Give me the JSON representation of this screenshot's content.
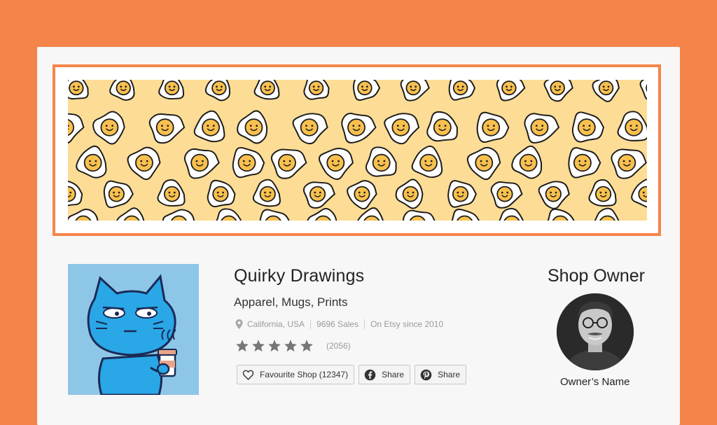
{
  "shop": {
    "name": "Quirky Drawings",
    "tagline": "Apparel, Mugs, Prints",
    "location": "California, USA",
    "sales": "9696 Sales",
    "since": "On Etsy since 2010",
    "review_count": "(2056)",
    "rating_stars": 5
  },
  "actions": {
    "favourite_label": "Favourite Shop (12347)",
    "facebook_share_label": "Share",
    "pinterest_share_label": "Share"
  },
  "owner": {
    "title": "Shop Owner",
    "name": "Owner’s Name"
  },
  "colors": {
    "background": "#f5844a",
    "banner_fill": "#fddc95",
    "avatar_bg": "#8ec6e8",
    "star": "#777777"
  },
  "icons": {
    "location": "map-pin-icon",
    "favourite": "heart-icon",
    "facebook": "facebook-icon",
    "pinterest": "pinterest-icon"
  }
}
